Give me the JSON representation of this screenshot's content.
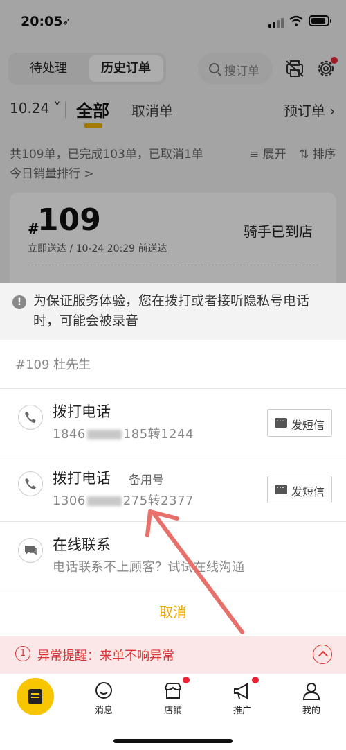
{
  "status_bar": {
    "time": "20:05",
    "location_glyph": "➶"
  },
  "header": {
    "segments": [
      "待处理",
      "历史订单"
    ],
    "active_segment": "历史订单",
    "search_placeholder": "搜订单",
    "icons": [
      "printer-off-icon",
      "gear-icon"
    ]
  },
  "tabs": {
    "date": "10.24",
    "all": "全部",
    "cancelled": "取消单",
    "preorder": "预订单 ›"
  },
  "summary": {
    "text": "共109单，已完成103单，已取消1单",
    "expand": "≡ 展开",
    "sort": "⇅ 排序",
    "rank": "今日销量排行 >"
  },
  "order": {
    "hash": "#",
    "number": "109",
    "sub": "立即送达 / 10-24 20:29 前送达",
    "status": "骑手已到店"
  },
  "sheet": {
    "notice_icon": "!",
    "notice": "为保证服务体验，您在拨打或者接听隐私号电话时，可能会被录音",
    "order_title": "#109 杜先生",
    "rows": [
      {
        "title": "拨打电话",
        "tag": "",
        "num_prefix": "1846",
        "num_suffix": "185转1244",
        "sms": "发短信"
      },
      {
        "title": "拨打电话",
        "tag": "备用号",
        "num_prefix": "1306",
        "num_suffix": "275转2377",
        "sms": "发短信"
      }
    ],
    "online": {
      "title": "在线联系",
      "subtitle": "电话联系不上顾客？试试在线沟通"
    },
    "cancel": "取消"
  },
  "alert": {
    "badge": "1",
    "text": "异常提醒：来单不响异常"
  },
  "nav": {
    "items": [
      "消息",
      "店铺",
      "推广",
      "我的"
    ]
  },
  "colors": {
    "brand_yellow": "#f7c600",
    "cancel_orange": "#f0a500",
    "alert_red": "#dd3333",
    "annotation_arrow": "#e8706a"
  }
}
